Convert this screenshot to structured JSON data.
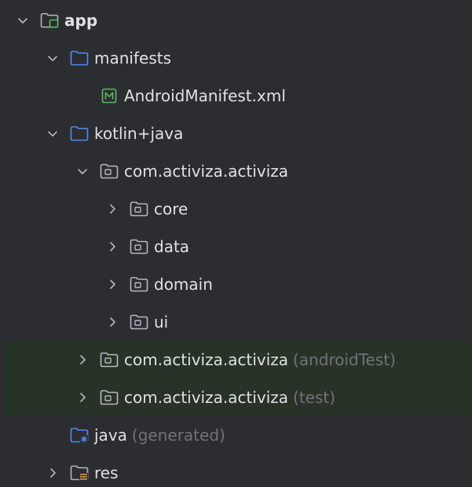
{
  "tree": [
    {
      "label": "app",
      "suffix": "",
      "level": 0,
      "chevron": "down",
      "icon": "module-folder-icon",
      "highlight": false,
      "bold": true
    },
    {
      "label": "manifests",
      "suffix": "",
      "level": 1,
      "chevron": "down",
      "icon": "folder-icon",
      "highlight": false,
      "bold": false
    },
    {
      "label": "AndroidManifest.xml",
      "suffix": "",
      "level": 2,
      "chevron": "none",
      "icon": "manifest-file-icon",
      "highlight": false,
      "bold": false
    },
    {
      "label": "kotlin+java",
      "suffix": "",
      "level": 1,
      "chevron": "down",
      "icon": "folder-icon",
      "highlight": false,
      "bold": false
    },
    {
      "label": "com.activiza.activiza",
      "suffix": "",
      "level": 2,
      "chevron": "down",
      "icon": "package-icon",
      "highlight": false,
      "bold": false
    },
    {
      "label": "core",
      "suffix": "",
      "level": 3,
      "chevron": "right",
      "icon": "package-icon",
      "highlight": false,
      "bold": false
    },
    {
      "label": "data",
      "suffix": "",
      "level": 3,
      "chevron": "right",
      "icon": "package-icon",
      "highlight": false,
      "bold": false
    },
    {
      "label": "domain",
      "suffix": "",
      "level": 3,
      "chevron": "right",
      "icon": "package-icon",
      "highlight": false,
      "bold": false
    },
    {
      "label": "ui",
      "suffix": "",
      "level": 3,
      "chevron": "right",
      "icon": "package-icon",
      "highlight": false,
      "bold": false
    },
    {
      "label": "com.activiza.activiza",
      "suffix": "(androidTest)",
      "level": 2,
      "chevron": "right",
      "icon": "package-icon",
      "highlight": true,
      "bold": false
    },
    {
      "label": "com.activiza.activiza",
      "suffix": "(test)",
      "level": 2,
      "chevron": "right",
      "icon": "package-icon",
      "highlight": true,
      "bold": false
    },
    {
      "label": "java",
      "suffix": "(generated)",
      "level": 1,
      "chevron": "none",
      "icon": "generated-folder-icon",
      "highlight": false,
      "bold": false
    },
    {
      "label": "res",
      "suffix": "",
      "level": 1,
      "chevron": "right",
      "icon": "resources-folder-icon",
      "highlight": false,
      "bold": false
    }
  ],
  "colors": {
    "background": "#2b2d30",
    "highlight": "#283327",
    "text": "#dfe1e5",
    "muted": "#6f737a",
    "folder_blue": "#548af7",
    "module_green": "#5fb865",
    "chevron": "#b4b8bf"
  }
}
